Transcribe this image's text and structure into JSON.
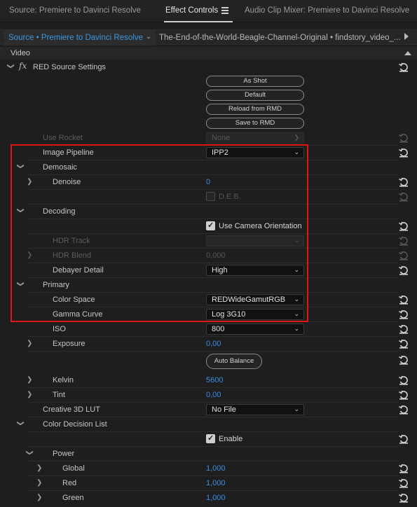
{
  "panel_tabs": [
    {
      "label": "Source: Premiere to Davinci Resolve",
      "active": false
    },
    {
      "label": "Effect Controls",
      "active": true
    },
    {
      "label": "Audio Clip Mixer: Premiere to Davinci Resolve",
      "active": false
    }
  ],
  "clip_bar": {
    "source_label": "Source • Premiere to Davinci Resolve",
    "sequence_label": "The-End-of-the-World-Beagle-Channel-Original • findstory_video_..."
  },
  "section": {
    "label": "Video"
  },
  "effect": {
    "fx": "fx",
    "name": "RED Source Settings"
  },
  "buttons": {
    "as_shot": "As Shot",
    "default": "Default",
    "reload_rmd": "Reload from RMD",
    "save_rmd": "Save to RMD",
    "auto_balance": "Auto Balance"
  },
  "rows": {
    "use_rocket": {
      "label": "Use Rocket",
      "value": "None"
    },
    "image_pipeline": {
      "label": "Image Pipeline",
      "value": "IPP2"
    },
    "demosaic": {
      "label": "Demosaic"
    },
    "denoise": {
      "label": "Denoise",
      "value": "0"
    },
    "deb": {
      "label": "D.E.B.",
      "checked": false
    },
    "decoding": {
      "label": "Decoding"
    },
    "use_camera_orientation": {
      "label": "Use Camera Orientation",
      "checked": true
    },
    "hdr_track": {
      "label": "HDR Track"
    },
    "hdr_blend": {
      "label": "HDR Blend",
      "value": "0,000"
    },
    "debayer_detail": {
      "label": "Debayer Detail",
      "value": "High"
    },
    "primary": {
      "label": "Primary"
    },
    "color_space": {
      "label": "Color Space",
      "value": "REDWideGamutRGB"
    },
    "gamma_curve": {
      "label": "Gamma Curve",
      "value": "Log 3G10"
    },
    "iso": {
      "label": "ISO",
      "value": "800"
    },
    "exposure": {
      "label": "Exposure",
      "value": "0,00"
    },
    "kelvin": {
      "label": "Kelvin",
      "value": "5600"
    },
    "tint": {
      "label": "Tint",
      "value": "0,00"
    },
    "creative_lut": {
      "label": "Creative 3D LUT",
      "value": "No File"
    },
    "cdl": {
      "label": "Color Decision List"
    },
    "cdl_enable": {
      "label": "Enable",
      "checked": true
    },
    "power": {
      "label": "Power"
    },
    "global": {
      "label": "Global",
      "value": "1,000"
    },
    "red": {
      "label": "Red",
      "value": "1,000"
    },
    "green": {
      "label": "Green",
      "value": "1,000"
    }
  },
  "colors": {
    "accent_blue": "#3b8de3",
    "highlight_box": "#e01515",
    "panel_bg": "#1e1e1e"
  },
  "icons": {
    "reset": "reset-parameter-icon",
    "menu": "panel-menu-icon",
    "dropdown": "chevron-down-icon",
    "twirl": "twirl-chevron-icon"
  }
}
